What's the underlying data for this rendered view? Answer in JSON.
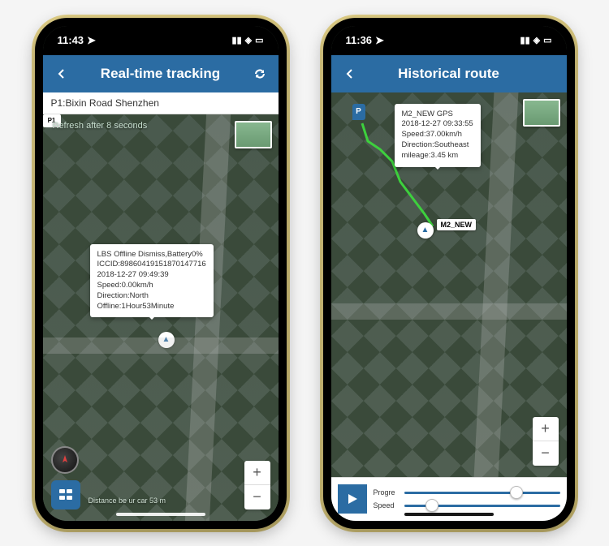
{
  "phone1": {
    "status_time": "11:43",
    "header": {
      "title": "Real-time tracking"
    },
    "subheader": "P1:Bixin Road Shenzhen",
    "refresh_text": "Refresh after 8 seconds",
    "callout": {
      "line1": "LBS Offline Dismiss,Battery0%",
      "line2": "ICCID:89860419151870147716",
      "line3": "2018-12-27 09:49:39",
      "line4": "Speed:0.00km/h",
      "line5": "Direction:North",
      "line6": "Offline:1Hour53Minute"
    },
    "marker_label": "P1",
    "distance_text": "Distance be   ur car 53 m"
  },
  "phone2": {
    "status_time": "11:36",
    "header": {
      "title": "Historical route"
    },
    "callout": {
      "line1": "M2_NEW  GPS",
      "line2": "2018-12-27 09:33:55",
      "line3": "Speed:37.00km/h",
      "line4": "Direction:Southeast",
      "line5": "mileage:3.45 km"
    },
    "marker_label": "M2_NEW",
    "park_label": "P",
    "playbar": {
      "progress_label": "Progre",
      "speed_label": "Speed"
    }
  },
  "zoom": {
    "in": "+",
    "out": "−"
  }
}
